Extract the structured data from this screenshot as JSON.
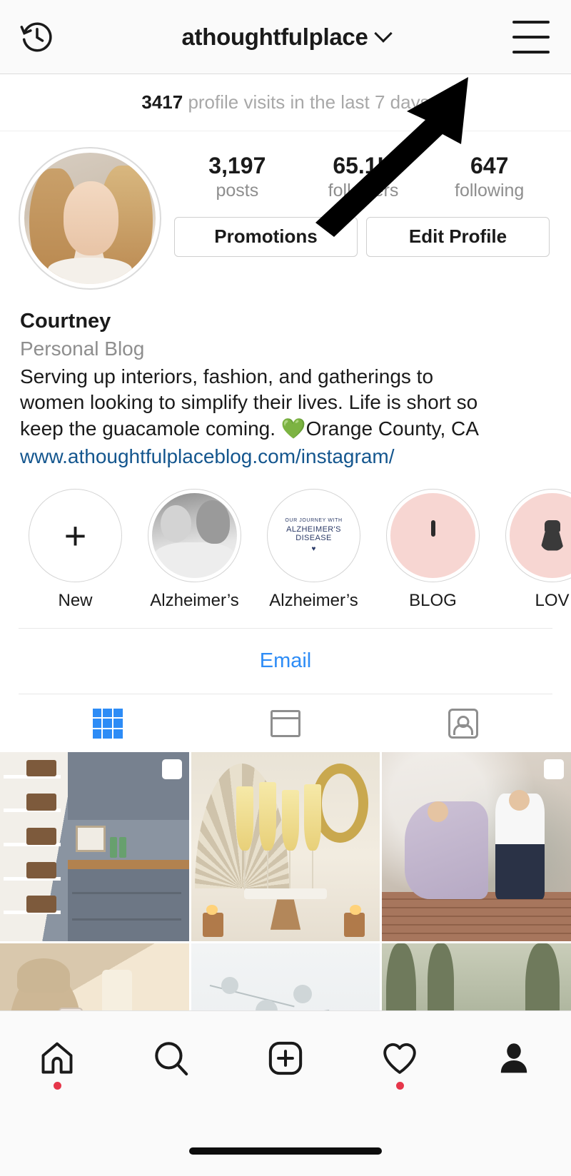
{
  "topbar": {
    "history_icon": "clock-history-icon",
    "username": "athoughtfulplace",
    "chevron_icon": "chevron-down-icon",
    "menu_icon": "hamburger-menu-icon"
  },
  "insights": {
    "count": "3417",
    "text": " profile visits in the last 7 days"
  },
  "profile": {
    "avatar_icon": "profile-avatar",
    "stats": [
      {
        "value": "3,197",
        "label": "posts"
      },
      {
        "value": "65.1K",
        "label": "followers"
      },
      {
        "value": "647",
        "label": "following"
      }
    ],
    "buttons": [
      {
        "label": "Promotions",
        "name": "promotions-button"
      },
      {
        "label": "Edit Profile",
        "name": "edit-profile-button"
      }
    ],
    "display_name": "Courtney",
    "category": "Personal Blog",
    "bio_line_1": "Serving up interiors, fashion, and gatherings to",
    "bio_line_2": "women looking to simplify their lives. Life is short so",
    "bio_line_3": "keep the guacamole coming. ",
    "bio_heart": "💚",
    "bio_line_3b": "Orange County, CA",
    "website": "www.athoughtfulplaceblog.com/instagram/"
  },
  "highlights": [
    {
      "label": "New",
      "icon": "plus-icon",
      "kind": "new"
    },
    {
      "label": "Alzheimer’s",
      "icon": "photo-thumbnail",
      "kind": "photo"
    },
    {
      "label": "Alzheimer’s",
      "icon": "text-cover",
      "kind": "text",
      "cover_line_1": "OUR JOURNEY WITH",
      "cover_line_2": "ALZHEIMER'S DISEASE",
      "cover_line_3": "♥"
    },
    {
      "label": "BLOG",
      "icon": "laptop-icon",
      "kind": "laptop"
    },
    {
      "label": "LOV",
      "icon": "dress-icon",
      "kind": "dress"
    }
  ],
  "email": {
    "label": "Email"
  },
  "tabs": [
    {
      "name": "tab-grid",
      "icon": "grid-icon",
      "active": true
    },
    {
      "name": "tab-feed",
      "icon": "feed-list-icon",
      "active": false
    },
    {
      "name": "tab-tagged",
      "icon": "tagged-person-icon",
      "active": false
    }
  ],
  "posts": [
    {
      "name": "post-pantry",
      "art": "pantry",
      "multi": true
    },
    {
      "name": "post-champagne",
      "art": "champ",
      "multi": false
    },
    {
      "name": "post-couple",
      "art": "couple",
      "multi": true
    },
    {
      "name": "post-selfie",
      "art": "selfie",
      "multi": false
    },
    {
      "name": "post-snow",
      "art": "snow",
      "multi": false
    },
    {
      "name": "post-family",
      "art": "family",
      "multi": false
    }
  ],
  "bottom_nav": [
    {
      "name": "nav-home",
      "icon": "home-icon",
      "badge": true
    },
    {
      "name": "nav-search",
      "icon": "search-icon",
      "badge": false
    },
    {
      "name": "nav-add",
      "icon": "plus-square-icon",
      "badge": false
    },
    {
      "name": "nav-activity",
      "icon": "heart-icon",
      "badge": true
    },
    {
      "name": "nav-profile",
      "icon": "person-icon",
      "badge": false
    }
  ],
  "annotation": {
    "arrow": "pointing-arrow",
    "color": "#000000"
  },
  "colors": {
    "accent_blue": "#2d8cf6",
    "link_blue": "#14568e",
    "badge_red": "#e6364a",
    "muted_gray": "#8e8e8e",
    "highlight_pink": "#f7d6d2"
  }
}
